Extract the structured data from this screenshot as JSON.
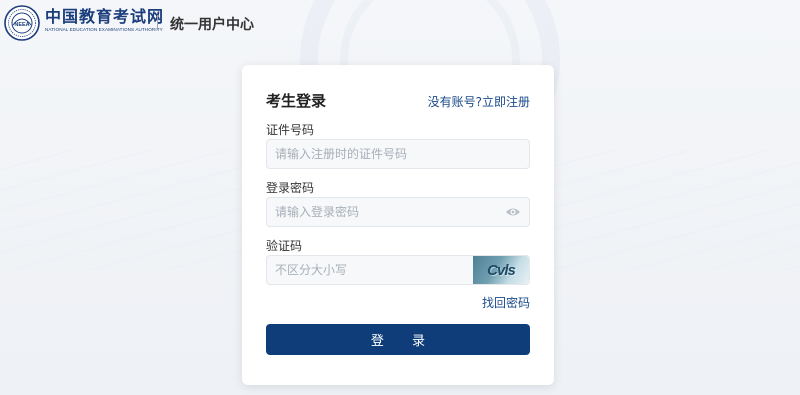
{
  "header": {
    "brand_cn": "中国教育考试网",
    "brand_en": "NATIONAL EDUCATION EXAMINATIONS AUTHORITY",
    "logo_text": "NEEA",
    "app_title": "统一用户中心"
  },
  "login": {
    "title": "考生登录",
    "register_link": "没有账号?立即注册",
    "id_label": "证件号码",
    "id_placeholder": "请输入注册时的证件号码",
    "password_label": "登录密码",
    "password_placeholder": "请输入登录密码",
    "captcha_label": "验证码",
    "captcha_placeholder": "不区分大小写",
    "captcha_text": "Cvls",
    "forgot_link": "找回密码",
    "submit": "登 录"
  },
  "colors": {
    "brand": "#1a3d7c",
    "button": "#0f3d7a",
    "link": "#1a4a8a"
  }
}
